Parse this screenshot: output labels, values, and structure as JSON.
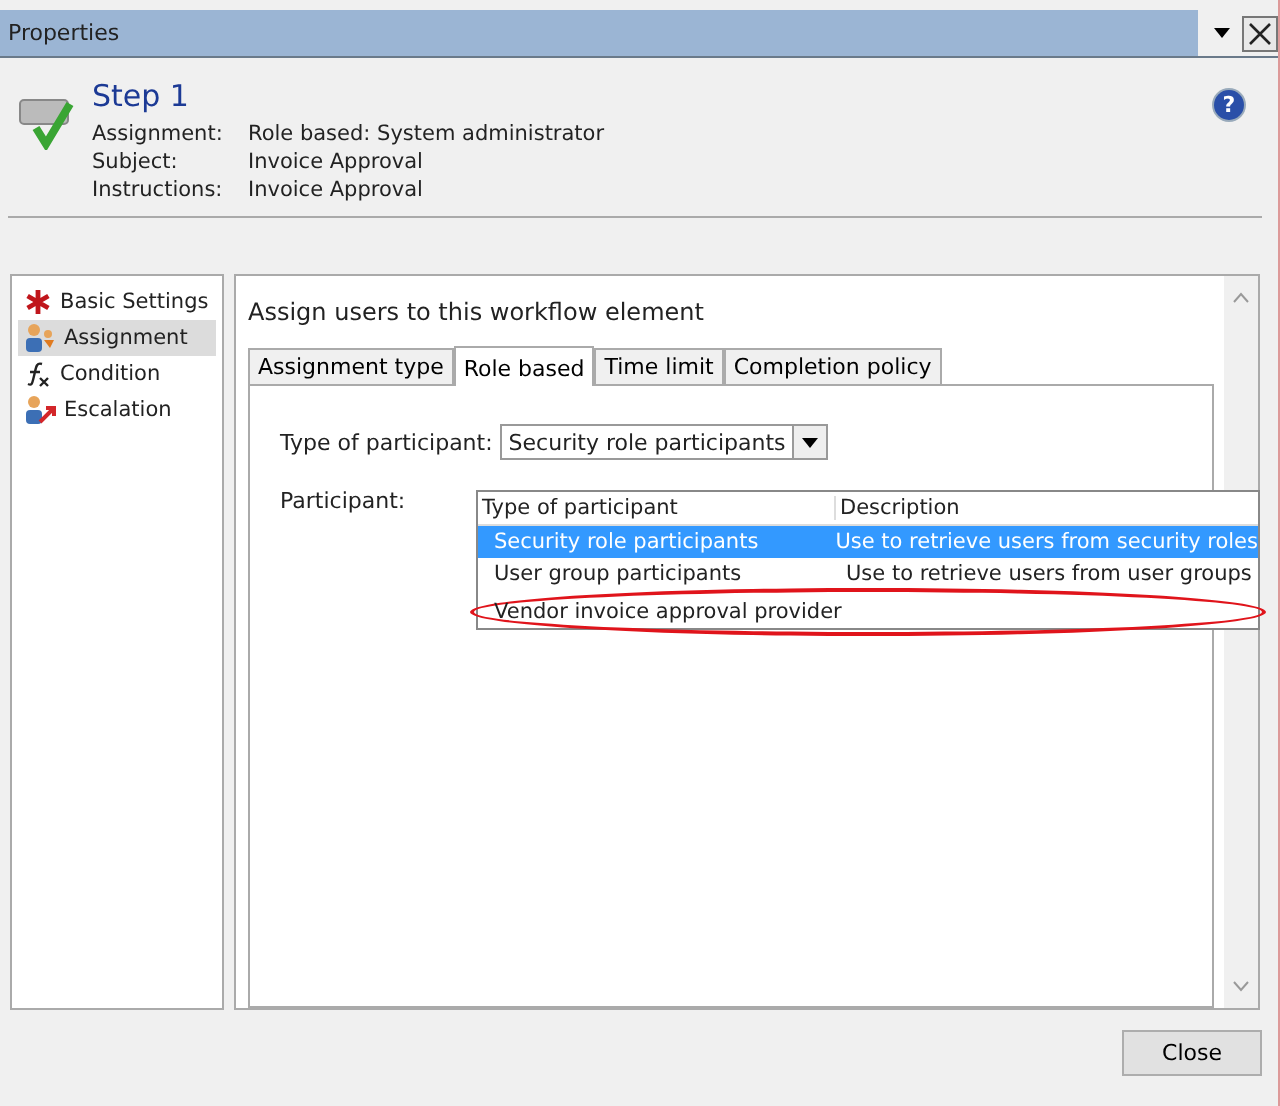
{
  "window": {
    "title": "Properties"
  },
  "header": {
    "title": "Step 1",
    "fields": [
      {
        "label": "Assignment:",
        "value": "Role based: System administrator"
      },
      {
        "label": "Subject:",
        "value": "Invoice Approval"
      },
      {
        "label": "Instructions:",
        "value": "Invoice Approval"
      }
    ]
  },
  "sidebar": {
    "items": [
      {
        "label": "Basic Settings",
        "kind": "star",
        "selected": false
      },
      {
        "label": "Assignment",
        "kind": "users",
        "selected": true
      },
      {
        "label": "Condition",
        "kind": "function",
        "selected": false
      },
      {
        "label": "Escalation",
        "kind": "escalation",
        "selected": false
      }
    ]
  },
  "panel": {
    "heading": "Assign users to this workflow element",
    "tabs": [
      {
        "label": "Assignment type",
        "selected": false
      },
      {
        "label": "Role based",
        "selected": true
      },
      {
        "label": "Time limit",
        "selected": false
      },
      {
        "label": "Completion policy",
        "selected": false
      }
    ],
    "type_of_participant": {
      "label": "Type of participant:",
      "value": "Security role participants"
    },
    "participant": {
      "label": "Participant:"
    },
    "dropdown": {
      "columns": [
        "Type of participant",
        "Description"
      ],
      "rows": [
        {
          "name": "Security role participants",
          "description": "Use to retrieve users from security roles",
          "selected": true,
          "highlighted": false
        },
        {
          "name": "User group participants",
          "description": "Use to retrieve users from user groups",
          "selected": false,
          "highlighted": false
        },
        {
          "name": "Vendor invoice approval provider",
          "description": "",
          "selected": false,
          "highlighted": true
        }
      ]
    }
  },
  "help": "?",
  "buttons": [
    "Close"
  ]
}
